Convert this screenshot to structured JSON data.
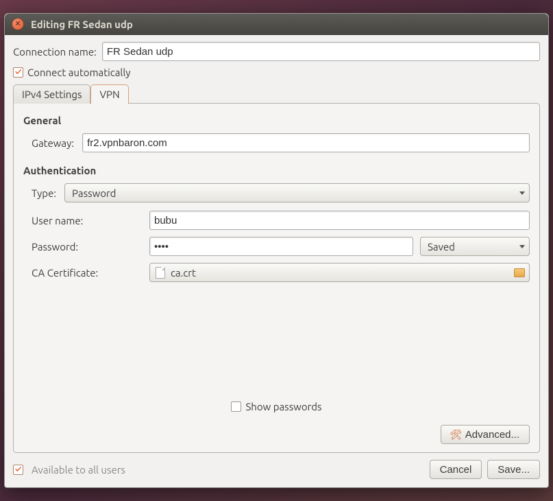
{
  "window": {
    "title": "Editing FR Sedan udp"
  },
  "connName": {
    "label": "Connection name:",
    "value": "FR Sedan udp"
  },
  "connectAuto": {
    "label": "Connect automatically",
    "checked": true
  },
  "tabs": {
    "ipv4": "IPv4 Settings",
    "vpn": "VPN",
    "active": "vpn"
  },
  "general": {
    "title": "General",
    "gatewayLabel": "Gateway:",
    "gatewayValue": "fr2.vpnbaron.com"
  },
  "auth": {
    "title": "Authentication",
    "typeLabel": "Type:",
    "typeValue": "Password",
    "userLabel": "User name:",
    "userValue": "bubu",
    "passwordLabel": "Password:",
    "passwordValue": "••••",
    "passwordMode": "Saved",
    "caLabel": "CA Certificate:",
    "caValue": "ca.crt"
  },
  "showPasswords": {
    "label": "Show passwords",
    "checked": false
  },
  "advanced": {
    "label": "Advanced..."
  },
  "footer": {
    "availAll": {
      "label": "Available to all users",
      "checked": true
    },
    "cancel": "Cancel",
    "save": "Save..."
  }
}
